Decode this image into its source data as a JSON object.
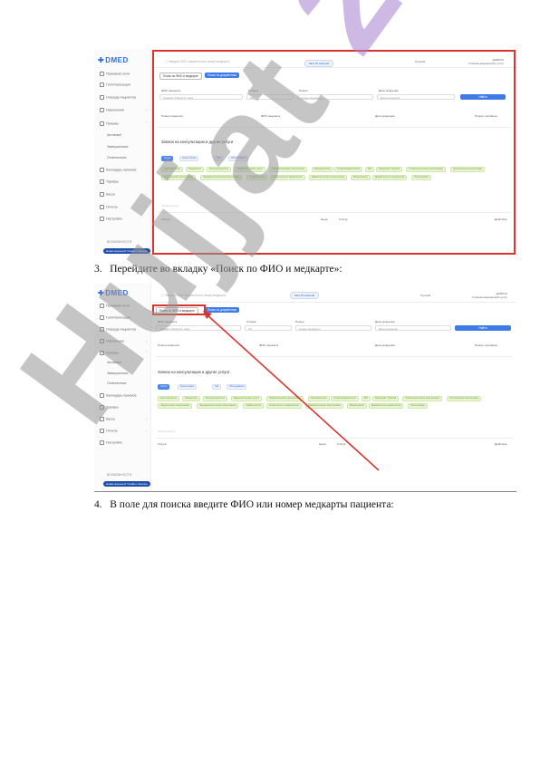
{
  "step3": {
    "number": "3.",
    "text": "Перейдите во вкладку «Поиск по ФИО и медкарте»:"
  },
  "step4": {
    "number": "4.",
    "text": "В поле для поиска введите ФИО или номер медкарты пациента:"
  },
  "watermark": {
    "text": "Hujjat",
    "number": "24",
    "color": "#9a9a9a",
    "accent": "#a77fce"
  },
  "app": {
    "logo": "DMED",
    "logo_color": "#2f6fe0",
    "sidebar_items": [
      "Приемная лечи",
      "Госпитализации",
      "Очередь пациентов",
      "Назначения",
      "Приемы"
    ],
    "sidebar_sub_items": [
      "Активные",
      "Завершенные",
      "Отмененные"
    ],
    "sidebar_items_lower": [
      "Календарь приемов",
      "Тарифы",
      "Касса",
      "Отчеты",
      "Настройки"
    ],
    "version_label": "ВОЗМОЖНОСТИ",
    "bottom_chip": "Новая функция! Узнайте больше",
    "search_placeholder": "Введите ФИО пациента или номер медкарты",
    "doc_badge": "Мои 15 записей",
    "lang": "Русский",
    "user": "ДАВРОН",
    "user_org": "Клиника медицинских услуг",
    "tabs": [
      "Поиск по ФИО и медкарте",
      "Поиск по документам"
    ],
    "filter_labels": [
      "ФИО пациента",
      "Страна",
      "Номер",
      "Дата рождения"
    ],
    "filter_values": [
      "Хорамит Рахим Ф. сана",
      "UZ",
      "Номер медкарты",
      "Дата рождения"
    ],
    "find_button": "Найти",
    "result_headers": [
      "Номер пациента",
      "ФИО пациента",
      "Дата рождения",
      "Номер телефона"
    ],
    "section_title": "Записи на консультацию и другие услуги",
    "section_tabs": [
      "Услуги",
      "Консультации",
      "Лаб",
      "Обследования"
    ],
    "service_pills": [
      "Анестезиология",
      "Гинекология",
      "Гастроэнтерология",
      "Кардиологические услуги",
      "Неврологические консультации",
      "Офтальмология",
      "Оториноларингология",
      "ЭКГ",
      "Педиатрия / Терапия",
      "Стоматологические консультации",
      "Урологические консультации",
      "Хирургические консультации",
      "Эндокринологические консультации",
      "Травматология",
      "Аллергология и иммунология",
      "Маммологические консультации",
      "Физиотерапия",
      "Дерматология и венерология",
      "Психотерапия"
    ],
    "search_small_placeholder": "Поиск услуги",
    "table_headers": [
      "Услуга",
      "Цена",
      "Статус",
      "Действие"
    ]
  }
}
